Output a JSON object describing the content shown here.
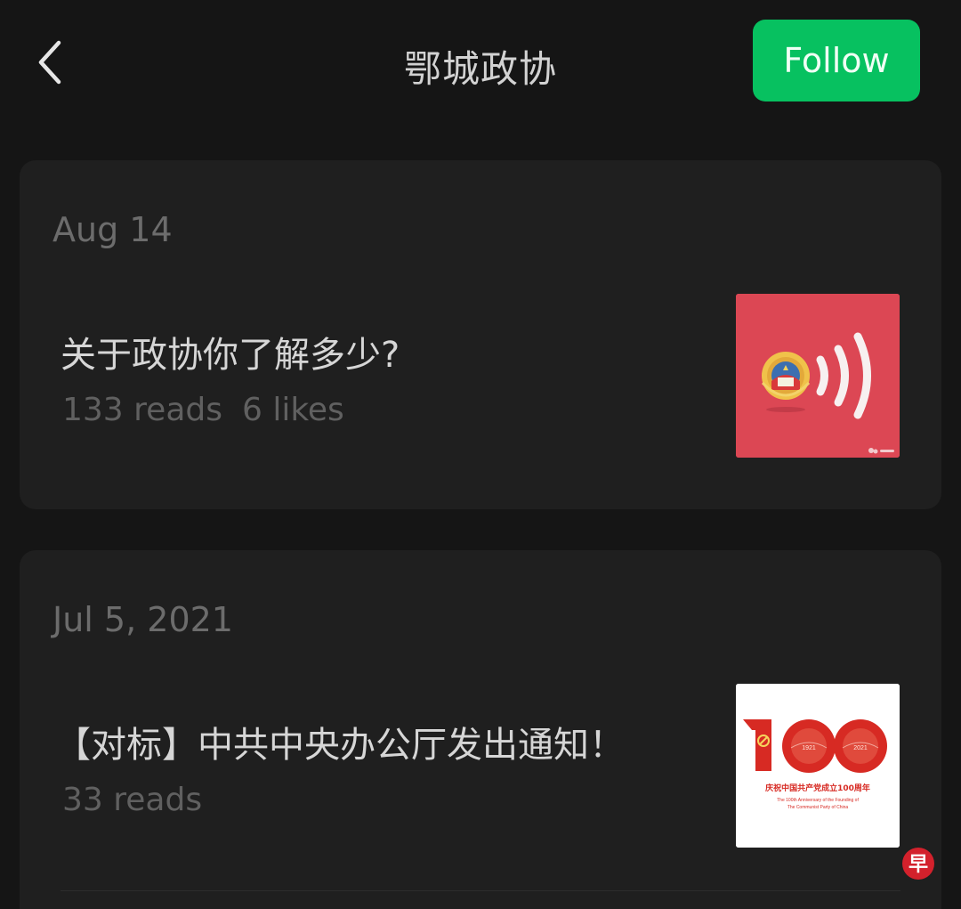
{
  "header": {
    "title": "鄂城政协",
    "follow_label": "Follow"
  },
  "articles": [
    {
      "date": "Aug 14",
      "title": "关于政协你了解多少?",
      "reads": "133 reads",
      "likes": "6 likes",
      "thumbnail": "cppcc-emblem-broadcast",
      "thumbnail_bg": "#dc4754"
    },
    {
      "date": "Jul 5, 2021",
      "title": "【对标】中共中央办公厅发出通知！",
      "reads": "33 reads",
      "thumbnail": "cpc-100th-anniversary-logo",
      "thumbnail_bg": "#ffffff",
      "thumbnail_text": {
        "number": "100",
        "year_left": "1921",
        "year_right": "2021",
        "caption_cn": "庆祝中国共产党成立100周年",
        "caption_en_1": "The 100th Anniversary of the Founding of",
        "caption_en_2": "The Communist Party of China"
      }
    }
  ],
  "colors": {
    "background": "#151515",
    "card": "#1f1f1f",
    "accent": "#07c160",
    "title_text": "#d6d6d6",
    "meta_text": "#606060"
  },
  "watermark": {
    "text": "早"
  }
}
